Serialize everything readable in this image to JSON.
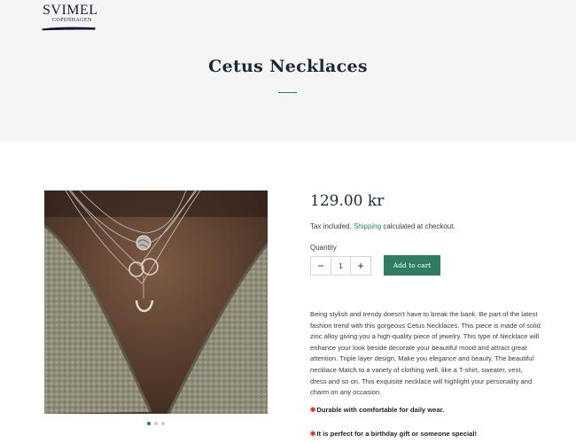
{
  "brand": {
    "name": "SVIMEL",
    "sub": "COPENHAGEN"
  },
  "page": {
    "title": "Cetus Necklaces"
  },
  "product": {
    "price": "129.00 kr",
    "tax_prefix": "Tax included.",
    "shipping_link": "Shipping",
    "tax_suffix": "calculated at checkout.",
    "quantity_label": "Quantity",
    "quantity_value": "1",
    "minus_label": "−",
    "plus_label": "+",
    "add_to_cart": "Add to cart",
    "description": "Being stylish and trendy doesn't have to break the bank. Be part of the latest fashion trend with this gorgeous Cetus Necklaces. This piece is made of solid zinc alloy giving you a high-quality piece of jewelry. This type of Necklace will enhance your look beside decorate your beautiful mood and attract great attention. Triple layer design, Make you elegance and beauty. The beautiful necklace Match to a variety of clothing well, like a T-shirt, sweater, vest, dress and so on. This exquisite necklace will highlight your personality and charm on any occasion.",
    "bullets": [
      {
        "star": "✱",
        "text": "Durable with comfortable for daily wear."
      },
      {
        "star": "✱",
        "text": "It is perfect for a birthday gift or someone special!"
      }
    ]
  },
  "gallery": {
    "slide_count": 3,
    "active_slide": 1
  },
  "colors": {
    "accent": "#2e7d63",
    "hero_bg": "#f5f5f5",
    "title": "#1e2a3a",
    "star": "#e0231b"
  }
}
